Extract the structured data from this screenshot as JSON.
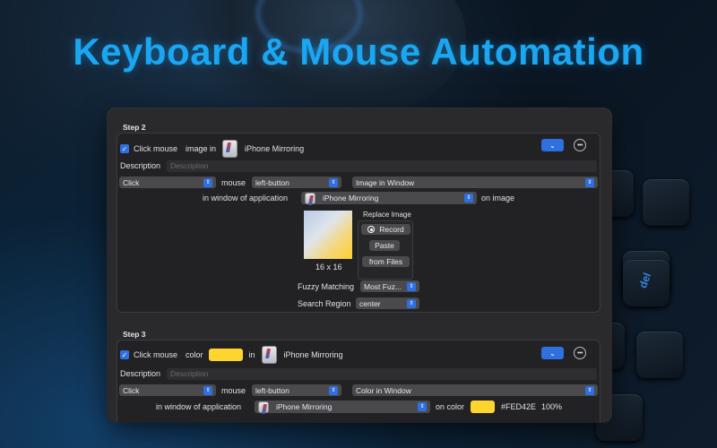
{
  "headline": "Keyboard & Mouse Automation",
  "background_keys": [
    "del"
  ],
  "accent_color": "#2f6fe0",
  "step2": {
    "title": "Step 2",
    "action": "Click mouse",
    "target_type": "image in",
    "app": "iPhone Mirroring",
    "description_label": "Description",
    "description_placeholder": "Description",
    "click_type": "Click",
    "mouse_label": "mouse",
    "button": "left-button",
    "mode": "Image in Window",
    "window_label": "in window of application",
    "window_app": "iPhone Mirroring",
    "on_label": "on image",
    "image_size": "16 x 16",
    "replace_title": "Replace Image",
    "record_label": "Record",
    "paste_label": "Paste",
    "files_label": "from Files",
    "fuzzy_label": "Fuzzy Matching",
    "fuzzy_value": "Most Fuz...",
    "region_label": "Search Region",
    "region_value": "center"
  },
  "step3": {
    "title": "Step 3",
    "action": "Click mouse",
    "target_type": "color",
    "in_label": "in",
    "app": "iPhone Mirroring",
    "color": "#FED42E",
    "description_label": "Description",
    "description_placeholder": "Description",
    "click_type": "Click",
    "mouse_label": "mouse",
    "button": "left-button",
    "mode": "Color in Window",
    "window_label": "in window of application",
    "window_app": "iPhone Mirroring",
    "on_label": "on color",
    "color_hex": "#FED42E",
    "tolerance": "100%"
  }
}
